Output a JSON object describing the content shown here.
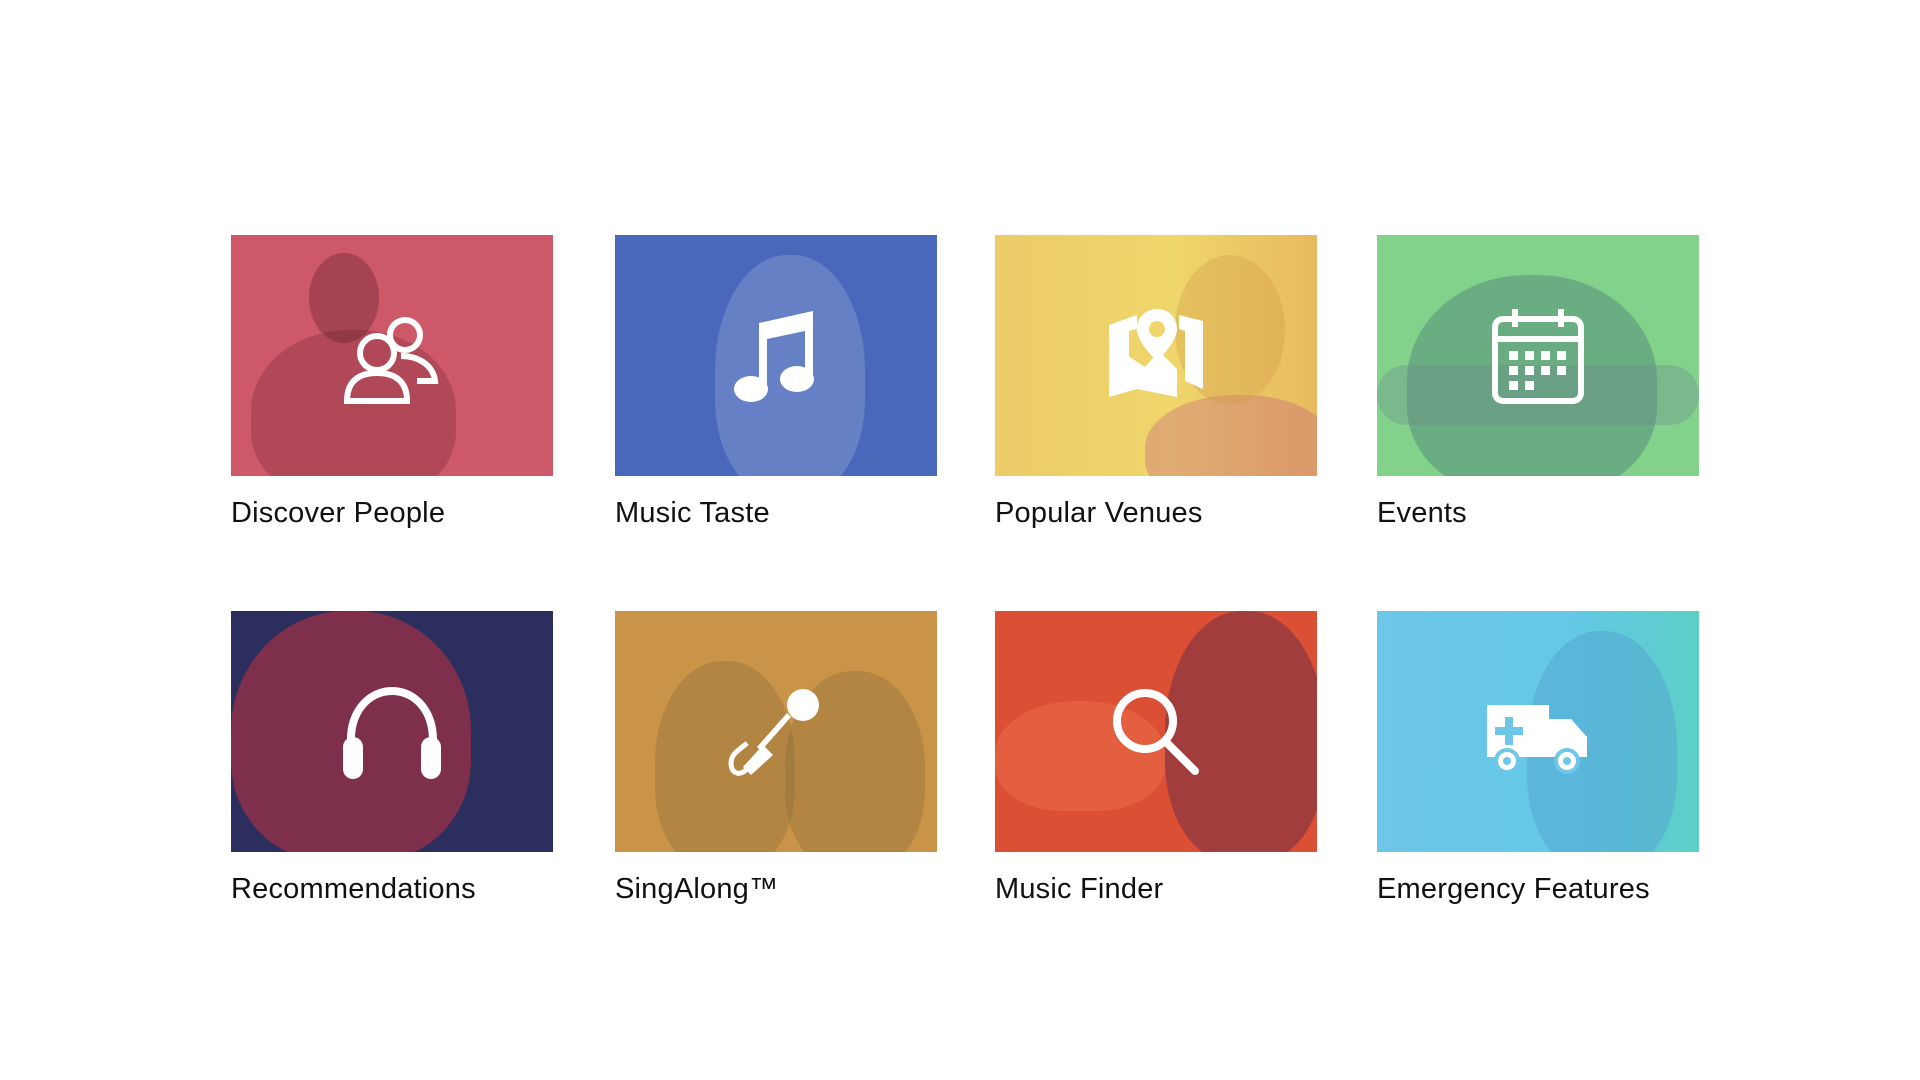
{
  "tiles": [
    {
      "label": "Discover People",
      "icon": "people-icon",
      "color": "#cc5868",
      "accent": "#8a3040"
    },
    {
      "label": "Music Taste",
      "icon": "music-note-icon",
      "color": "#4a68bb",
      "accent": "#8ea6d8"
    },
    {
      "label": "Popular Venues",
      "icon": "map-pin-icon",
      "color": "#eecb6a",
      "accent": "#d98a73"
    },
    {
      "label": "Events",
      "icon": "calendar-icon",
      "color": "#82d28c",
      "accent": "#5a8f8a"
    },
    {
      "label": "Recommendations",
      "icon": "headphones-icon",
      "color": "#2c2f5e",
      "accent": "#c3303c"
    },
    {
      "label": "SingAlong™",
      "icon": "microphone-icon",
      "color": "#c99447",
      "accent": "#a8773a"
    },
    {
      "label": "Music Finder",
      "icon": "magnifier-icon",
      "color": "#db4f35",
      "accent": "#7a2f4a"
    },
    {
      "label": "Emergency Features",
      "icon": "ambulance-icon",
      "color": "#6ec6e8",
      "accent": "#5ccfc7"
    }
  ]
}
